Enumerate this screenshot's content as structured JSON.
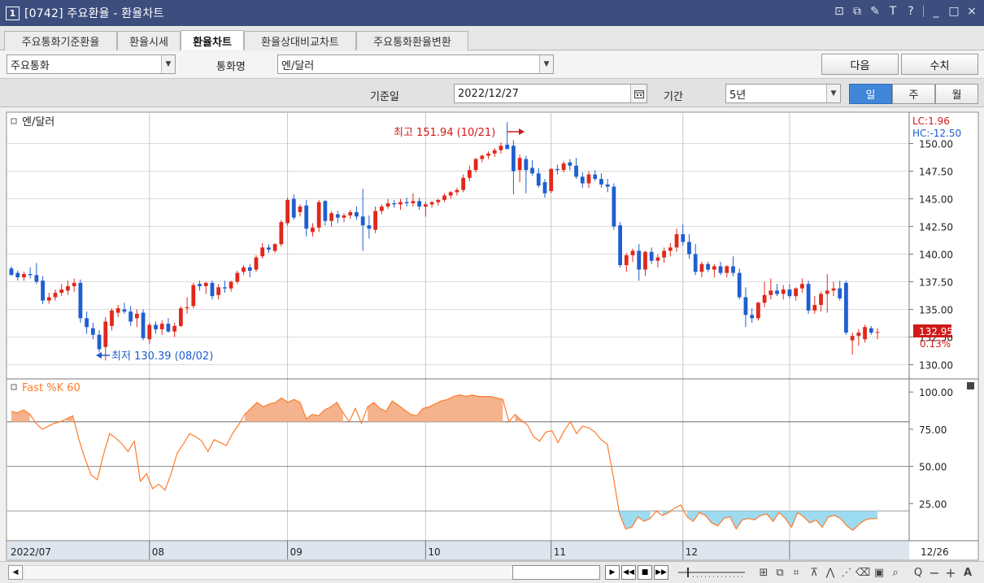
{
  "window": {
    "number": "1",
    "title": "[0742] 주요환율 - 환율차트",
    "icons": [
      "restore-icon",
      "cascade-icon",
      "pin-icon",
      "font-icon",
      "help-icon",
      "minimize-icon",
      "maximize-icon",
      "close-icon"
    ]
  },
  "tabs": [
    {
      "label": "주요통화기준환율",
      "active": false
    },
    {
      "label": "환율시세",
      "active": false
    },
    {
      "label": "환율차트",
      "active": true
    },
    {
      "label": "환율상대비교차트",
      "active": false
    },
    {
      "label": "주요통화환율변환",
      "active": false
    }
  ],
  "controls": {
    "category": "주요통화",
    "currency_label": "통화명",
    "currency": "엔/달러",
    "next_button": "다음",
    "values_button": "수치",
    "base_date_label": "기준일",
    "base_date": "2022/12/27",
    "period_label": "기간",
    "period": "5년",
    "periods": [
      {
        "label": "일",
        "active": true
      },
      {
        "label": "주",
        "active": false
      },
      {
        "label": "월",
        "active": false
      }
    ]
  },
  "chart_data": {
    "type": "candlestick",
    "title": "엔/달러",
    "legend_lc": "LC:1.96",
    "legend_hc": "HC:-12.50",
    "y_ticks": [
      "150.00",
      "147.50",
      "145.00",
      "142.50",
      "140.00",
      "137.50",
      "135.00",
      "132.50",
      "130.00"
    ],
    "ylim": [
      129.3,
      152.1
    ],
    "current_price": "132.95",
    "current_change": "0.13%",
    "high_annotation": "최고 151.94 (10/21)",
    "low_annotation": "최저 130.39 (08/02)",
    "x_labels": [
      {
        "label": "2022/07",
        "index": 0
      },
      {
        "label": "08",
        "index": 22
      },
      {
        "label": "09",
        "index": 44
      },
      {
        "label": "10",
        "index": 66
      },
      {
        "label": "11",
        "index": 86
      },
      {
        "label": "12",
        "index": 107
      },
      {
        "label": "12/26",
        "index": 124
      }
    ],
    "candles": [
      [
        138.7,
        138.9,
        138.1,
        138.1
      ],
      [
        138.3,
        138.5,
        137.6,
        137.9
      ],
      [
        137.9,
        138.4,
        137.6,
        138.2
      ],
      [
        138.2,
        138.8,
        137.8,
        138.1
      ],
      [
        138.1,
        139.2,
        137.3,
        137.5
      ],
      [
        137.6,
        138.0,
        135.5,
        135.8
      ],
      [
        135.8,
        136.5,
        135.5,
        136.1
      ],
      [
        136.1,
        136.8,
        135.8,
        136.5
      ],
      [
        136.5,
        137.3,
        136.2,
        136.8
      ],
      [
        136.7,
        137.6,
        136.3,
        137.1
      ],
      [
        137.1,
        137.8,
        136.6,
        137.4
      ],
      [
        137.4,
        137.7,
        133.8,
        134.2
      ],
      [
        134.2,
        134.8,
        132.8,
        133.4
      ],
      [
        133.3,
        133.8,
        132.3,
        132.7
      ],
      [
        132.7,
        133.1,
        131.1,
        131.4
      ],
      [
        131.6,
        134.3,
        130.39,
        133.9
      ],
      [
        133.5,
        135.1,
        133.1,
        134.9
      ],
      [
        134.7,
        135.4,
        134.3,
        135.1
      ],
      [
        135.0,
        135.6,
        134.6,
        134.8
      ],
      [
        134.8,
        135.3,
        133.5,
        133.9
      ],
      [
        134.2,
        135.0,
        133.4,
        134.6
      ],
      [
        134.7,
        135.0,
        132.2,
        132.4
      ],
      [
        132.3,
        133.8,
        131.9,
        133.6
      ],
      [
        133.6,
        133.9,
        132.8,
        133.2
      ],
      [
        133.2,
        134.0,
        132.7,
        133.7
      ],
      [
        133.7,
        134.2,
        132.9,
        133.0
      ],
      [
        133.0,
        133.8,
        132.5,
        133.5
      ],
      [
        133.5,
        135.3,
        133.4,
        135.1
      ],
      [
        135.1,
        136.1,
        134.6,
        135.2
      ],
      [
        135.3,
        137.4,
        135.1,
        137.2
      ],
      [
        137.3,
        137.6,
        136.7,
        137.1
      ],
      [
        137.1,
        137.5,
        136.4,
        137.4
      ],
      [
        137.4,
        137.6,
        135.9,
        136.2
      ],
      [
        136.3,
        137.3,
        135.9,
        137.0
      ],
      [
        137.0,
        137.6,
        136.5,
        136.9
      ],
      [
        136.9,
        137.6,
        136.6,
        137.5
      ],
      [
        137.5,
        138.5,
        137.3,
        138.3
      ],
      [
        138.4,
        139.0,
        138.1,
        138.8
      ],
      [
        138.8,
        139.1,
        137.9,
        138.5
      ],
      [
        138.6,
        139.9,
        138.4,
        139.7
      ],
      [
        139.8,
        141.0,
        139.6,
        140.6
      ],
      [
        140.6,
        140.9,
        140.1,
        140.4
      ],
      [
        140.3,
        141.0,
        140.1,
        140.9
      ],
      [
        140.9,
        143.1,
        140.7,
        142.9
      ],
      [
        142.8,
        145.1,
        142.6,
        144.9
      ],
      [
        145.0,
        145.4,
        143.1,
        143.3
      ],
      [
        143.8,
        144.5,
        143.4,
        144.3
      ],
      [
        144.4,
        144.9,
        141.6,
        142.3
      ],
      [
        142.0,
        142.8,
        141.6,
        142.4
      ],
      [
        142.4,
        144.9,
        142.0,
        144.7
      ],
      [
        144.8,
        144.9,
        142.6,
        143.0
      ],
      [
        143.0,
        143.9,
        142.5,
        143.7
      ],
      [
        143.6,
        143.9,
        142.8,
        143.3
      ],
      [
        143.3,
        143.7,
        142.9,
        143.5
      ],
      [
        143.5,
        144.0,
        143.2,
        143.8
      ],
      [
        143.8,
        144.3,
        143.1,
        143.4
      ],
      [
        143.4,
        145.9,
        140.3,
        142.6
      ],
      [
        142.6,
        143.5,
        141.4,
        142.3
      ],
      [
        142.2,
        144.3,
        141.9,
        143.9
      ],
      [
        143.9,
        144.5,
        143.6,
        144.3
      ],
      [
        144.3,
        145.0,
        144.1,
        144.6
      ],
      [
        144.6,
        144.9,
        144.2,
        144.5
      ],
      [
        144.5,
        145.0,
        144.0,
        144.7
      ],
      [
        144.7,
        145.1,
        144.3,
        144.6
      ],
      [
        144.6,
        145.5,
        144.3,
        144.8
      ],
      [
        144.8,
        145.1,
        144.0,
        144.3
      ],
      [
        144.3,
        144.7,
        143.4,
        144.5
      ],
      [
        144.5,
        144.8,
        144.2,
        144.7
      ],
      [
        144.7,
        145.0,
        144.4,
        144.9
      ],
      [
        144.9,
        145.5,
        144.7,
        145.3
      ],
      [
        145.3,
        145.7,
        145.0,
        145.6
      ],
      [
        145.6,
        146.0,
        145.3,
        145.8
      ],
      [
        145.8,
        147.2,
        145.6,
        146.9
      ],
      [
        146.9,
        148.0,
        146.6,
        147.6
      ],
      [
        147.6,
        148.7,
        147.4,
        148.6
      ],
      [
        148.6,
        149.0,
        148.3,
        148.9
      ],
      [
        148.9,
        149.3,
        148.6,
        149.1
      ],
      [
        149.1,
        149.6,
        148.8,
        149.4
      ],
      [
        149.4,
        150.1,
        149.1,
        149.8
      ],
      [
        149.9,
        151.94,
        149.6,
        149.5
      ],
      [
        149.8,
        150.3,
        145.4,
        147.5
      ],
      [
        147.6,
        149.0,
        146.5,
        148.7
      ],
      [
        148.6,
        148.9,
        145.5,
        147.6
      ],
      [
        147.8,
        148.5,
        147.1,
        147.3
      ],
      [
        147.3,
        147.8,
        146.0,
        146.2
      ],
      [
        146.5,
        146.8,
        145.1,
        145.5
      ],
      [
        145.7,
        147.8,
        145.5,
        147.7
      ],
      [
        147.7,
        148.1,
        147.2,
        147.6
      ],
      [
        147.6,
        148.4,
        147.4,
        148.2
      ],
      [
        148.3,
        148.6,
        147.6,
        148.0
      ],
      [
        148.0,
        148.7,
        146.8,
        147.0
      ],
      [
        147.0,
        147.4,
        146.0,
        146.4
      ],
      [
        146.4,
        147.5,
        146.0,
        147.2
      ],
      [
        147.2,
        147.6,
        146.6,
        146.8
      ],
      [
        146.8,
        147.3,
        146.0,
        146.3
      ],
      [
        146.3,
        146.8,
        145.6,
        146.1
      ],
      [
        146.1,
        146.4,
        142.2,
        142.5
      ],
      [
        142.6,
        142.9,
        138.8,
        139.0
      ],
      [
        139.0,
        140.1,
        138.4,
        139.9
      ],
      [
        139.9,
        140.5,
        139.3,
        140.3
      ],
      [
        140.3,
        140.9,
        137.6,
        138.6
      ],
      [
        138.6,
        140.3,
        138.0,
        140.2
      ],
      [
        140.2,
        140.6,
        139.1,
        139.4
      ],
      [
        139.4,
        140.0,
        138.8,
        139.7
      ],
      [
        139.7,
        140.6,
        139.2,
        140.3
      ],
      [
        140.3,
        141.0,
        139.8,
        140.6
      ],
      [
        140.6,
        142.3,
        140.2,
        141.8
      ],
      [
        141.8,
        142.7,
        140.8,
        141.1
      ],
      [
        141.1,
        141.8,
        139.6,
        140.0
      ],
      [
        140.0,
        140.9,
        138.1,
        138.4
      ]
    ],
    "candles_tail": [
      [
        138.4,
        139.3,
        137.9,
        139.1
      ],
      [
        139.1,
        139.3,
        138.4,
        138.6
      ],
      [
        138.6,
        139.1,
        137.9,
        138.9
      ],
      [
        138.9,
        139.3,
        138.1,
        138.3
      ],
      [
        138.3,
        139.0,
        137.9,
        138.9
      ],
      [
        138.9,
        139.8,
        138.0,
        138.3
      ],
      [
        138.3,
        138.7,
        135.9,
        136.1
      ],
      [
        136.1,
        137.0,
        133.4,
        134.5
      ],
      [
        134.5,
        135.1,
        133.8,
        134.2
      ],
      [
        134.2,
        135.7,
        134.0,
        135.6
      ],
      [
        135.6,
        137.5,
        135.2,
        136.3
      ],
      [
        136.3,
        137.8,
        135.9,
        136.7
      ],
      [
        136.7,
        137.3,
        136.2,
        136.4
      ],
      [
        136.4,
        137.2,
        135.9,
        136.8
      ],
      [
        136.8,
        137.3,
        136.0,
        136.2
      ],
      [
        136.2,
        137.0,
        135.8,
        136.9
      ],
      [
        136.9,
        137.8,
        136.5,
        137.3
      ],
      [
        137.3,
        137.6,
        134.6,
        134.9
      ],
      [
        134.9,
        136.2,
        134.6,
        135.4
      ],
      [
        135.4,
        136.6,
        134.8,
        136.4
      ],
      [
        136.4,
        138.2,
        134.7,
        136.7
      ],
      [
        136.7,
        137.5,
        136.2,
        136.9
      ],
      [
        136.9,
        137.6,
        135.8,
        136.0
      ],
      [
        137.4,
        137.6,
        132.7,
        132.9
      ],
      [
        132.2,
        132.9,
        130.9,
        132.6
      ],
      [
        132.6,
        133.2,
        131.7,
        132.9
      ],
      [
        132.3,
        133.6,
        132.0,
        133.4
      ],
      [
        133.3,
        133.5,
        132.7,
        132.9
      ],
      [
        132.9,
        133.3,
        132.3,
        132.95
      ]
    ],
    "indicator": {
      "name": "Fast %K 60",
      "y_ticks": [
        "100.00",
        "75.00",
        "50.00",
        "25.00"
      ],
      "ylim": [
        0,
        105
      ],
      "upper_level": 80,
      "lower_level": 20,
      "values": [
        87,
        86,
        88,
        85,
        79,
        75,
        77,
        79,
        80,
        82,
        84,
        68,
        55,
        44,
        41,
        58,
        72,
        69,
        65,
        60,
        67,
        40,
        45,
        35,
        38,
        34,
        45,
        59,
        65,
        72,
        70,
        67,
        60,
        68,
        66,
        64,
        72,
        78,
        85,
        89,
        93,
        90,
        92,
        93,
        96,
        93,
        95,
        93,
        82,
        85,
        84,
        88,
        90,
        93,
        86,
        80,
        89,
        79,
        90,
        93,
        89,
        87,
        94,
        91,
        88,
        85,
        84,
        89,
        90,
        92,
        94,
        95,
        97,
        98,
        97,
        98,
        97,
        97,
        97,
        96,
        95,
        80,
        85,
        81,
        78,
        70,
        67,
        73,
        74,
        66,
        74,
        80,
        72,
        77,
        76,
        73,
        68,
        65,
        43,
        18,
        8,
        9,
        16,
        13,
        15,
        20,
        17,
        19,
        22,
        24,
        16,
        13,
        19,
        17,
        12,
        10,
        15,
        16,
        8,
        14,
        15,
        14,
        17,
        18,
        13,
        19,
        15,
        9,
        19,
        16,
        12,
        14,
        9,
        16,
        17,
        15,
        10,
        7,
        11,
        14,
        15,
        15
      ]
    }
  },
  "bottom_toolbar": {
    "tools": [
      "scroll-left-icon",
      "play-icon",
      "rewind-icon",
      "stop-icon",
      "fast-forward-icon",
      "zoom-slider-icon",
      "chart-layout-icon",
      "window-icon",
      "crosshair-icon",
      "trend-line-icon",
      "pattern-icon",
      "draw-icon",
      "eraser-icon",
      "save-chart-icon",
      "search-icon",
      "zoom-out-icon",
      "zoom-in-icon",
      "text-tool-icon"
    ]
  }
}
